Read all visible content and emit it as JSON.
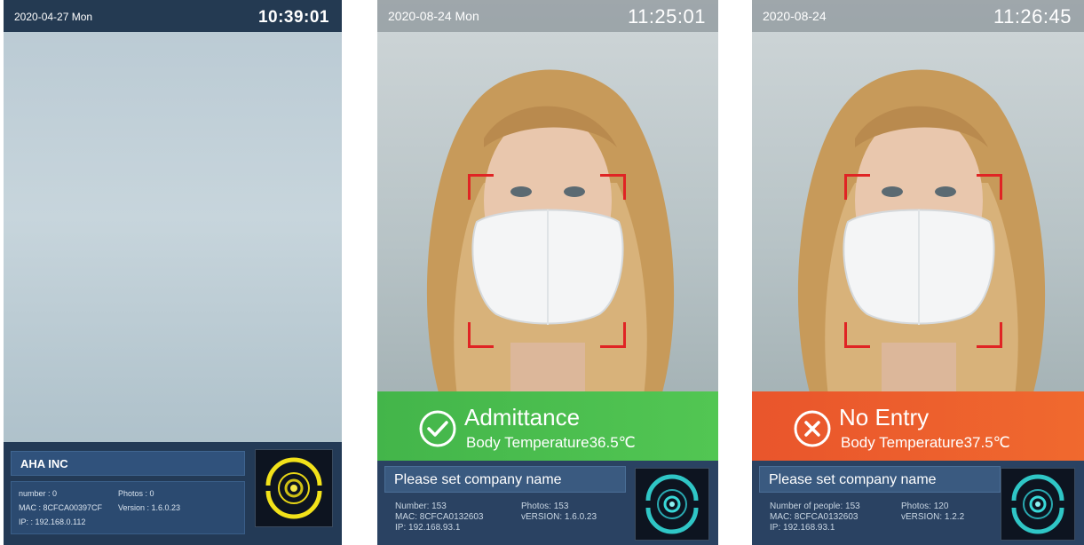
{
  "screens": [
    {
      "date": "2020-04-27 Mon",
      "time": "10:39:01",
      "company": "AHA INC",
      "number_label": "number : 0",
      "photos_label": "Photos : 0",
      "mac_label": "MAC : 8CFCA00397CF",
      "version_label": "Version : 1.6.0.23",
      "ip_label": "IP: : 192.168.0.112"
    },
    {
      "date": "2020-08-24 Mon",
      "time": "11:25:01",
      "status": "Admittance",
      "temperature": "Body Temperature36.5℃",
      "company": "Please set company name",
      "number_label": "Number: 153",
      "photos_label": "Photos: 153",
      "mac_label": "MAC: 8CFCA0132603",
      "version_label": "vERSION: 1.6.0.23",
      "ip_label": "IP: 192.168.93.1"
    },
    {
      "date": "2020-08-24",
      "time": "11:26:45",
      "status": "No Entry",
      "temperature": "Body Temperature37.5℃",
      "company": "Please set company name",
      "number_label": "Number of people: 153",
      "photos_label": "Photos: 120",
      "mac_label": "MAC: 8CFCA0132603",
      "version_label": "vERSION: 1.2.2",
      "ip_label": "IP: 192.168.93.1"
    }
  ],
  "colors": {
    "admit": "#4bbd4e",
    "deny": "#ec5f2d",
    "panel": "#233a56",
    "frame": "#e02424",
    "scanner_ring": "#2fc6c6",
    "scanner_yellow": "#f2e21a"
  },
  "icons": {
    "admit": "check-circle-icon",
    "deny": "x-circle-icon",
    "scanner": "face-scan-icon"
  }
}
